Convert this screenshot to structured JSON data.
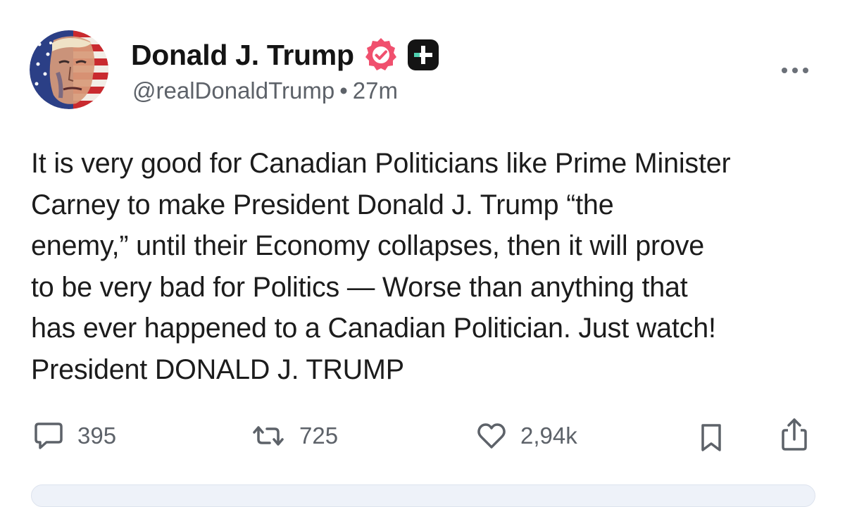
{
  "post": {
    "author": {
      "display_name": "Donald J. Trump",
      "handle": "@realDonaldTrump",
      "separator": "•",
      "time_ago": "27m",
      "verified_badge": "verified-badge-icon",
      "plus_badge": "plus-badge-icon"
    },
    "body": "It is very good for Canadian Politicians like Prime Minister\nCarney to make President Donald J. Trump “the\nenemy,” until their Economy collapses, then it will prove\nto be very bad for Politics — Worse than anything that\nhas ever happened to a Canadian Politician. Just watch!\nPresident DONALD J. TRUMP",
    "actions": {
      "replies": "395",
      "restruths": "725",
      "likes": "2,94k"
    },
    "colors": {
      "verified": "#f0506e",
      "icon_gray": "#5d6269",
      "text": "#141414"
    }
  }
}
